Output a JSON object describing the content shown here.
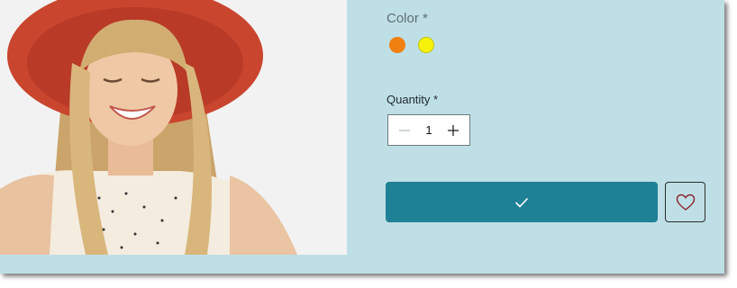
{
  "product": {
    "image_alt": "Smiling woman wearing a red sun hat",
    "color": {
      "label": "Color *",
      "options": [
        {
          "name": "orange",
          "hex": "#f0800f"
        },
        {
          "name": "yellow",
          "hex": "#f6f20a"
        }
      ]
    },
    "quantity": {
      "label": "Quantity *",
      "value": "1"
    },
    "actions": {
      "add_to_cart_icon": "check-icon",
      "wishlist_icon": "heart-icon"
    }
  },
  "colors": {
    "panel_bg": "#bfdfe6",
    "button": "#1f8196",
    "heart": "#8a1f2a"
  }
}
